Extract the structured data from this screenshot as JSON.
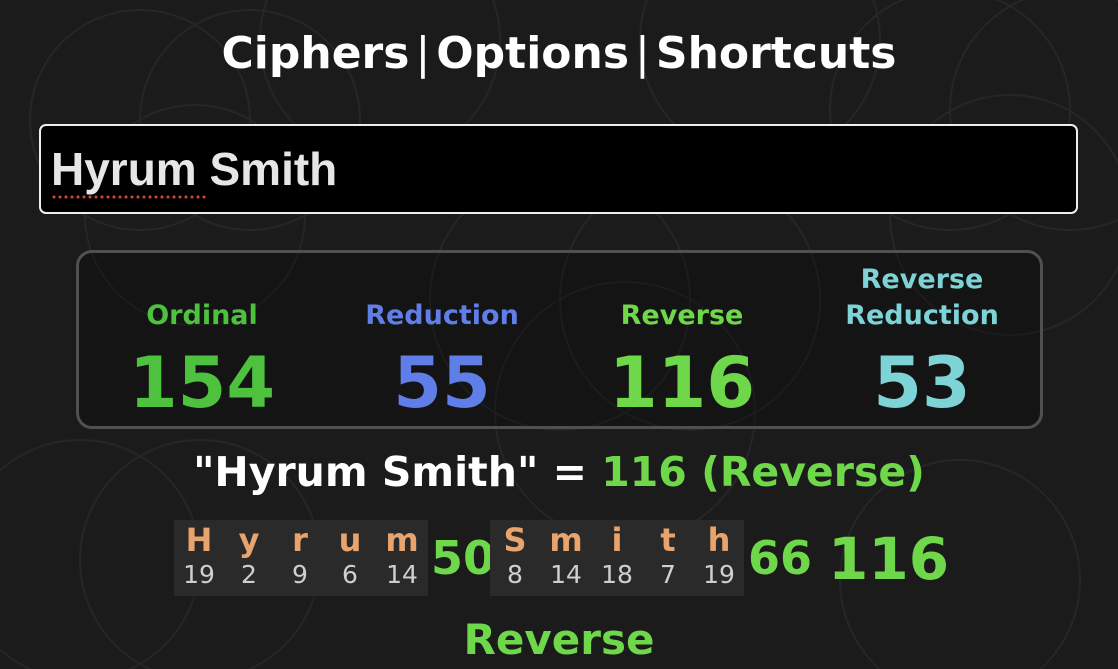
{
  "nav": {
    "items": [
      "Ciphers",
      "Options",
      "Shortcuts"
    ],
    "separator": "|"
  },
  "input": {
    "value": "Hyrum Smith"
  },
  "ciphers": [
    {
      "name_lines": [
        "Ordinal"
      ],
      "value": "154",
      "color": "#4ec23f"
    },
    {
      "name_lines": [
        "Reduction"
      ],
      "value": "55",
      "color": "#5f7ee8"
    },
    {
      "name_lines": [
        "Reverse"
      ],
      "value": "116",
      "color": "#6fd84a"
    },
    {
      "name_lines": [
        "Reverse",
        "Reduction"
      ],
      "value": "53",
      "color": "#7dd3d6"
    }
  ],
  "result": {
    "phrase": "\"Hyrum Smith\" = ",
    "value_text": "116 (Reverse)"
  },
  "breakdown": {
    "words": [
      {
        "letters": [
          {
            "ch": "H",
            "num": "19"
          },
          {
            "ch": "y",
            "num": "2"
          },
          {
            "ch": "r",
            "num": "9"
          },
          {
            "ch": "u",
            "num": "6"
          },
          {
            "ch": "m",
            "num": "14"
          }
        ],
        "total": "50"
      },
      {
        "letters": [
          {
            "ch": "S",
            "num": "8"
          },
          {
            "ch": "m",
            "num": "14"
          },
          {
            "ch": "i",
            "num": "18"
          },
          {
            "ch": "t",
            "num": "7"
          },
          {
            "ch": "h",
            "num": "19"
          }
        ],
        "total": "66"
      }
    ],
    "grand_total": "116"
  },
  "cipher_label": "Reverse",
  "colors": {
    "accent": "#6fd84a",
    "letter": "#e8a46c",
    "background": "#1b1b1b"
  }
}
